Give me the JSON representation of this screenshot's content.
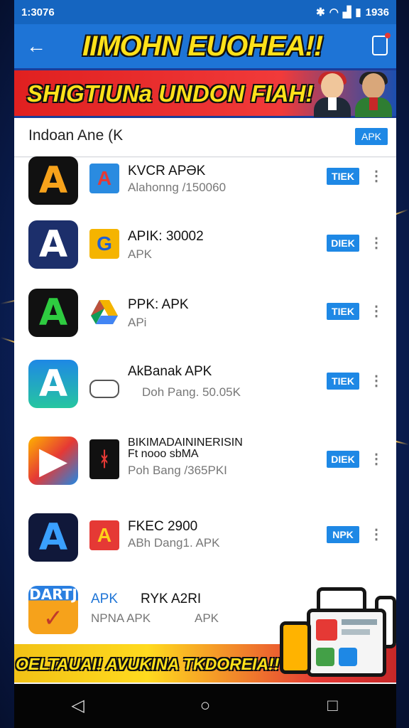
{
  "status": {
    "time": "1:3076",
    "battery": "1936"
  },
  "appbar": {
    "title": "IIMOHN EUOHEA!!"
  },
  "banner": {
    "text": "SHIGTIUNa UNDON FIAH!"
  },
  "search": {
    "value": "Indoan Ane (K",
    "chip": "APK"
  },
  "list": [
    {
      "name": "KVCR APƏK",
      "sub": "Alahonng /150060",
      "button": "TIEK",
      "big_icon": "a-logo-black-orange",
      "small_icon": "a-logo-blue"
    },
    {
      "name": "APIK: 30002",
      "sub": "APK",
      "button": "DIEK",
      "big_icon": "a-logo-navy",
      "small_icon": "orange-blue-square"
    },
    {
      "name": "PPK: APK",
      "sub": "APi",
      "button": "TIEK",
      "big_icon": "a-logo-green",
      "small_icon": "google-drive-triangle"
    },
    {
      "name": "AkBanak APK",
      "sub": "Doh Pang. 50.05K",
      "button": "TIEK",
      "big_icon": "a-logo-teal",
      "small_icon": "outline-badge"
    },
    {
      "name": "BIKIMADAININERISIN",
      "name2": "Ft nooo sbMA",
      "sub": "Poh Bang /365PKI",
      "button": "DIEK",
      "big_icon": "colorful-play",
      "small_icon": "red-black-figure"
    },
    {
      "name": "FKEC 2900",
      "sub": "ABh Dang1. APK",
      "button": "NPK",
      "big_icon": "a-logo-dark-blue",
      "small_icon": "a-logo-red-blue"
    },
    {
      "name": "RYK A2RI",
      "name_prefix": "APK",
      "sub": "NPNA APK",
      "sub2": "APK",
      "big_icon": "darti-orange",
      "button": ""
    }
  ],
  "footer": {
    "text": "OELTAUAI! AVUKINA TKDOREIA!!"
  },
  "colors": {
    "primary": "#1e74d6",
    "accent_yellow": "#ffe11a",
    "banner_red": "#e02020",
    "button_blue": "#1e88e5"
  }
}
